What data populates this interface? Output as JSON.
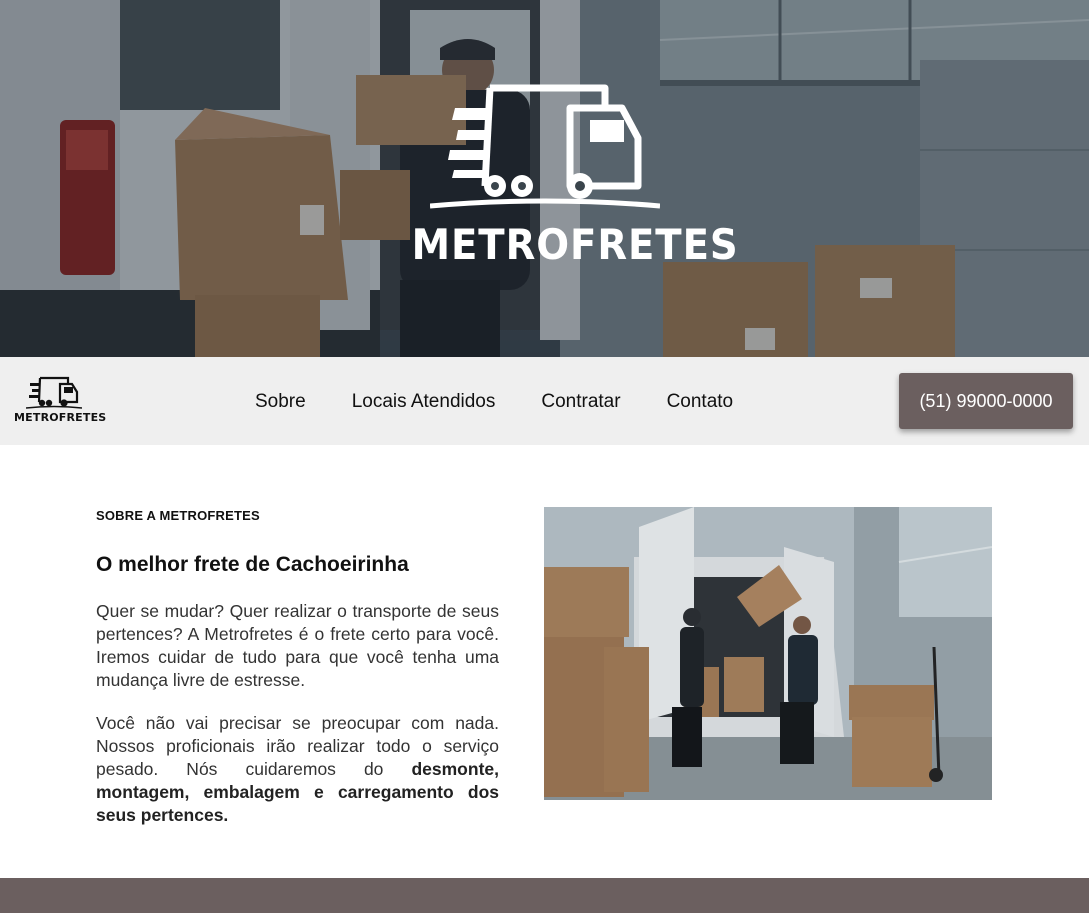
{
  "hero": {
    "brand": "METROFRETES",
    "logo_icon": "truck-icon"
  },
  "nav": {
    "logo_brand": "METROFRETES",
    "logo_icon": "truck-icon",
    "links": [
      "Sobre",
      "Locais Atendidos",
      "Contratar",
      "Contato"
    ],
    "phone": "(51) 99000-0000"
  },
  "about": {
    "label": "SOBRE A METROFRETES",
    "title": "O melhor frete de Cachoeirinha",
    "p1": "Quer se mudar? Quer realizar o transporte de seus pertences? A Metrofretes é o frete certo para você. Iremos cuidar de tudo para que você tenha uma mudança livre de estresse.",
    "p2_prefix": "Você não vai precisar se preocupar com nada. Nossos proficionais irão realizar todo o serviço pesado. Nós cuidaremos do ",
    "p2_bold": "desmonte, montagem, embalagem e carregamento dos seus pertences."
  },
  "colors": {
    "accent": "#6b5f5f",
    "nav_bg": "#efefef",
    "text": "#333333"
  }
}
